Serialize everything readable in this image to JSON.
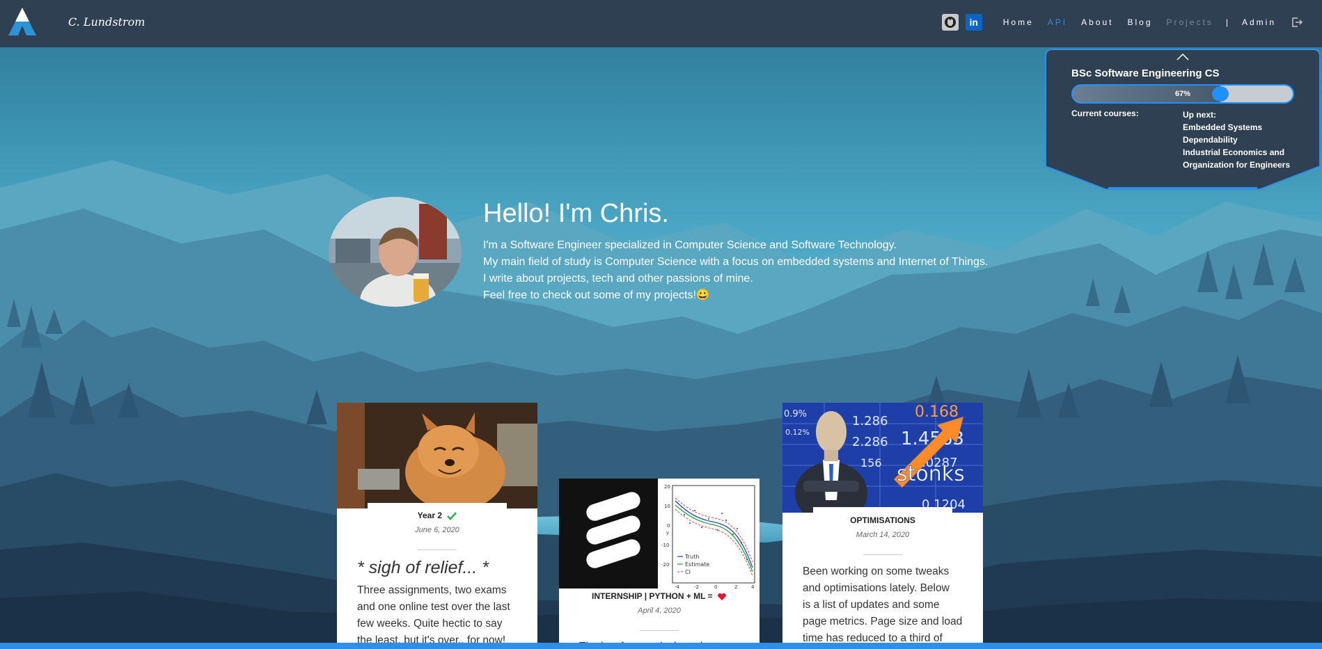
{
  "brand": {
    "name": "C. Lundstrom",
    "logo_icon": "mountain-logo-icon"
  },
  "nav": {
    "github_icon": "github-icon",
    "linkedin_icon": "linkedin-icon",
    "linkedin_text": "in",
    "items": [
      {
        "label": "Home",
        "state": "normal"
      },
      {
        "label": "API",
        "state": "active"
      },
      {
        "label": "About",
        "state": "normal"
      },
      {
        "label": "Blog",
        "state": "normal"
      },
      {
        "label": "Projects",
        "state": "dim"
      }
    ],
    "separator": "|",
    "admin": "Admin",
    "logout_icon": "logout-icon",
    "active_color": "#2e8fe6"
  },
  "degree": {
    "title": "BSc Software Engineering CS",
    "progress_label": "67%",
    "progress": 0.67,
    "current_courses_label": "Current courses:",
    "up_next_label": "Up next:",
    "up_next": [
      "Embedded Systems",
      "Dependability",
      "Industrial Economics and Organization for Engineers"
    ],
    "accent": "#1e90ff"
  },
  "hero": {
    "title": "Hello! I'm Chris.",
    "lines": [
      "I'm a Software Engineer specialized in Computer Science and Software Technology.",
      "My main field of study is Computer Science with a focus on embedded systems and Internet of Things.",
      "I write about projects, tech and other passions of mine.",
      "Feel free to check out some of my projects!"
    ],
    "emoji": "😀"
  },
  "cards": [
    {
      "title": "Year 2",
      "title_icon": "check-icon",
      "date": "June 6, 2020",
      "heading": "* sigh of relief... *",
      "body": [
        "Three assignments, two exams",
        "and one online test over the last",
        "few weeks. Quite hectic to say",
        "the least, but it's over.. for now!"
      ]
    },
    {
      "title": "INTERNSHIP | PYTHON + ML =",
      "title_icon": "heart-icon",
      "date": "April 4, 2020",
      "body": [
        "The last few weeks have been"
      ],
      "plot": {
        "legend": [
          "Truth",
          "Estimate",
          "CI"
        ],
        "y_ticks": [
          "20",
          "10",
          "0",
          "-10",
          "-20"
        ],
        "x_ticks": [
          "-4",
          "-2",
          "0",
          "2",
          "4"
        ],
        "y_label": "y"
      }
    },
    {
      "title": "OPTIMISATIONS",
      "date": "March 14, 2020",
      "body": [
        "Been working on some tweaks",
        "and optimisations lately. Below",
        "is a list of updates and some",
        "page metrics. Page size and load",
        "time has reduced to a third of"
      ],
      "image_text": [
        "0.9%",
        "0.12%",
        "1.286",
        "2.286",
        "156",
        "0.168",
        "1.4563",
        ".0287",
        "0.1204",
        "stonks"
      ]
    }
  ]
}
